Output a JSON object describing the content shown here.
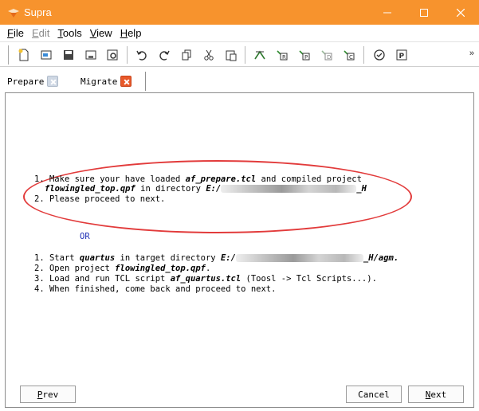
{
  "window": {
    "title": "Supra"
  },
  "menu": {
    "items": [
      {
        "label": "File",
        "key": "F",
        "rest": "ile",
        "enabled": true
      },
      {
        "label": "Edit",
        "key": "E",
        "rest": "dit",
        "enabled": false
      },
      {
        "label": "Tools",
        "key": "T",
        "rest": "ools",
        "enabled": true
      },
      {
        "label": "View",
        "key": "V",
        "rest": "iew",
        "enabled": true
      },
      {
        "label": "Help",
        "key": "H",
        "rest": "elp",
        "enabled": true
      }
    ]
  },
  "toolbar": {
    "overflow": "»"
  },
  "tabs": [
    {
      "label": "Prepare",
      "active": false
    },
    {
      "label": "Migrate",
      "active": true
    }
  ],
  "content": {
    "step1": {
      "num": "1.",
      "t1": "Make sure your have loaded ",
      "script": "af_prepare.tcl",
      "t2": " and compiled project",
      "project": "flowingled_top.qpf",
      "t3": " in directory ",
      "drive": "E:/",
      "dir_end": "_H"
    },
    "step2": "2. Please proceed to next.",
    "or_label": "OR",
    "alt1": {
      "num": "1.",
      "t1": "Start ",
      "tool": "quartus",
      "t2": " in target directory ",
      "drive": "E:/",
      "dir_end": "_H/agm."
    },
    "alt2": {
      "num": "2.",
      "t1": "Open project ",
      "project": "flowingled_top.qpf",
      "t2": "."
    },
    "alt3": {
      "num": "3.",
      "t1": "Load and run TCL script ",
      "script": "af_quartus.tcl",
      "t2": " (Toosl -> Tcl Scripts...)."
    },
    "alt4": "4. When finished, come back and proceed to next."
  },
  "buttons": {
    "prev": {
      "key": "P",
      "rest": "rev"
    },
    "cancel": "Cancel",
    "next": {
      "key": "N",
      "rest": "ext"
    }
  },
  "colors": {
    "titlebar": "#f7932d",
    "annotation": "#e23b3b",
    "or_text": "#1e2fb5",
    "active_tab_close": "#e8592a"
  }
}
